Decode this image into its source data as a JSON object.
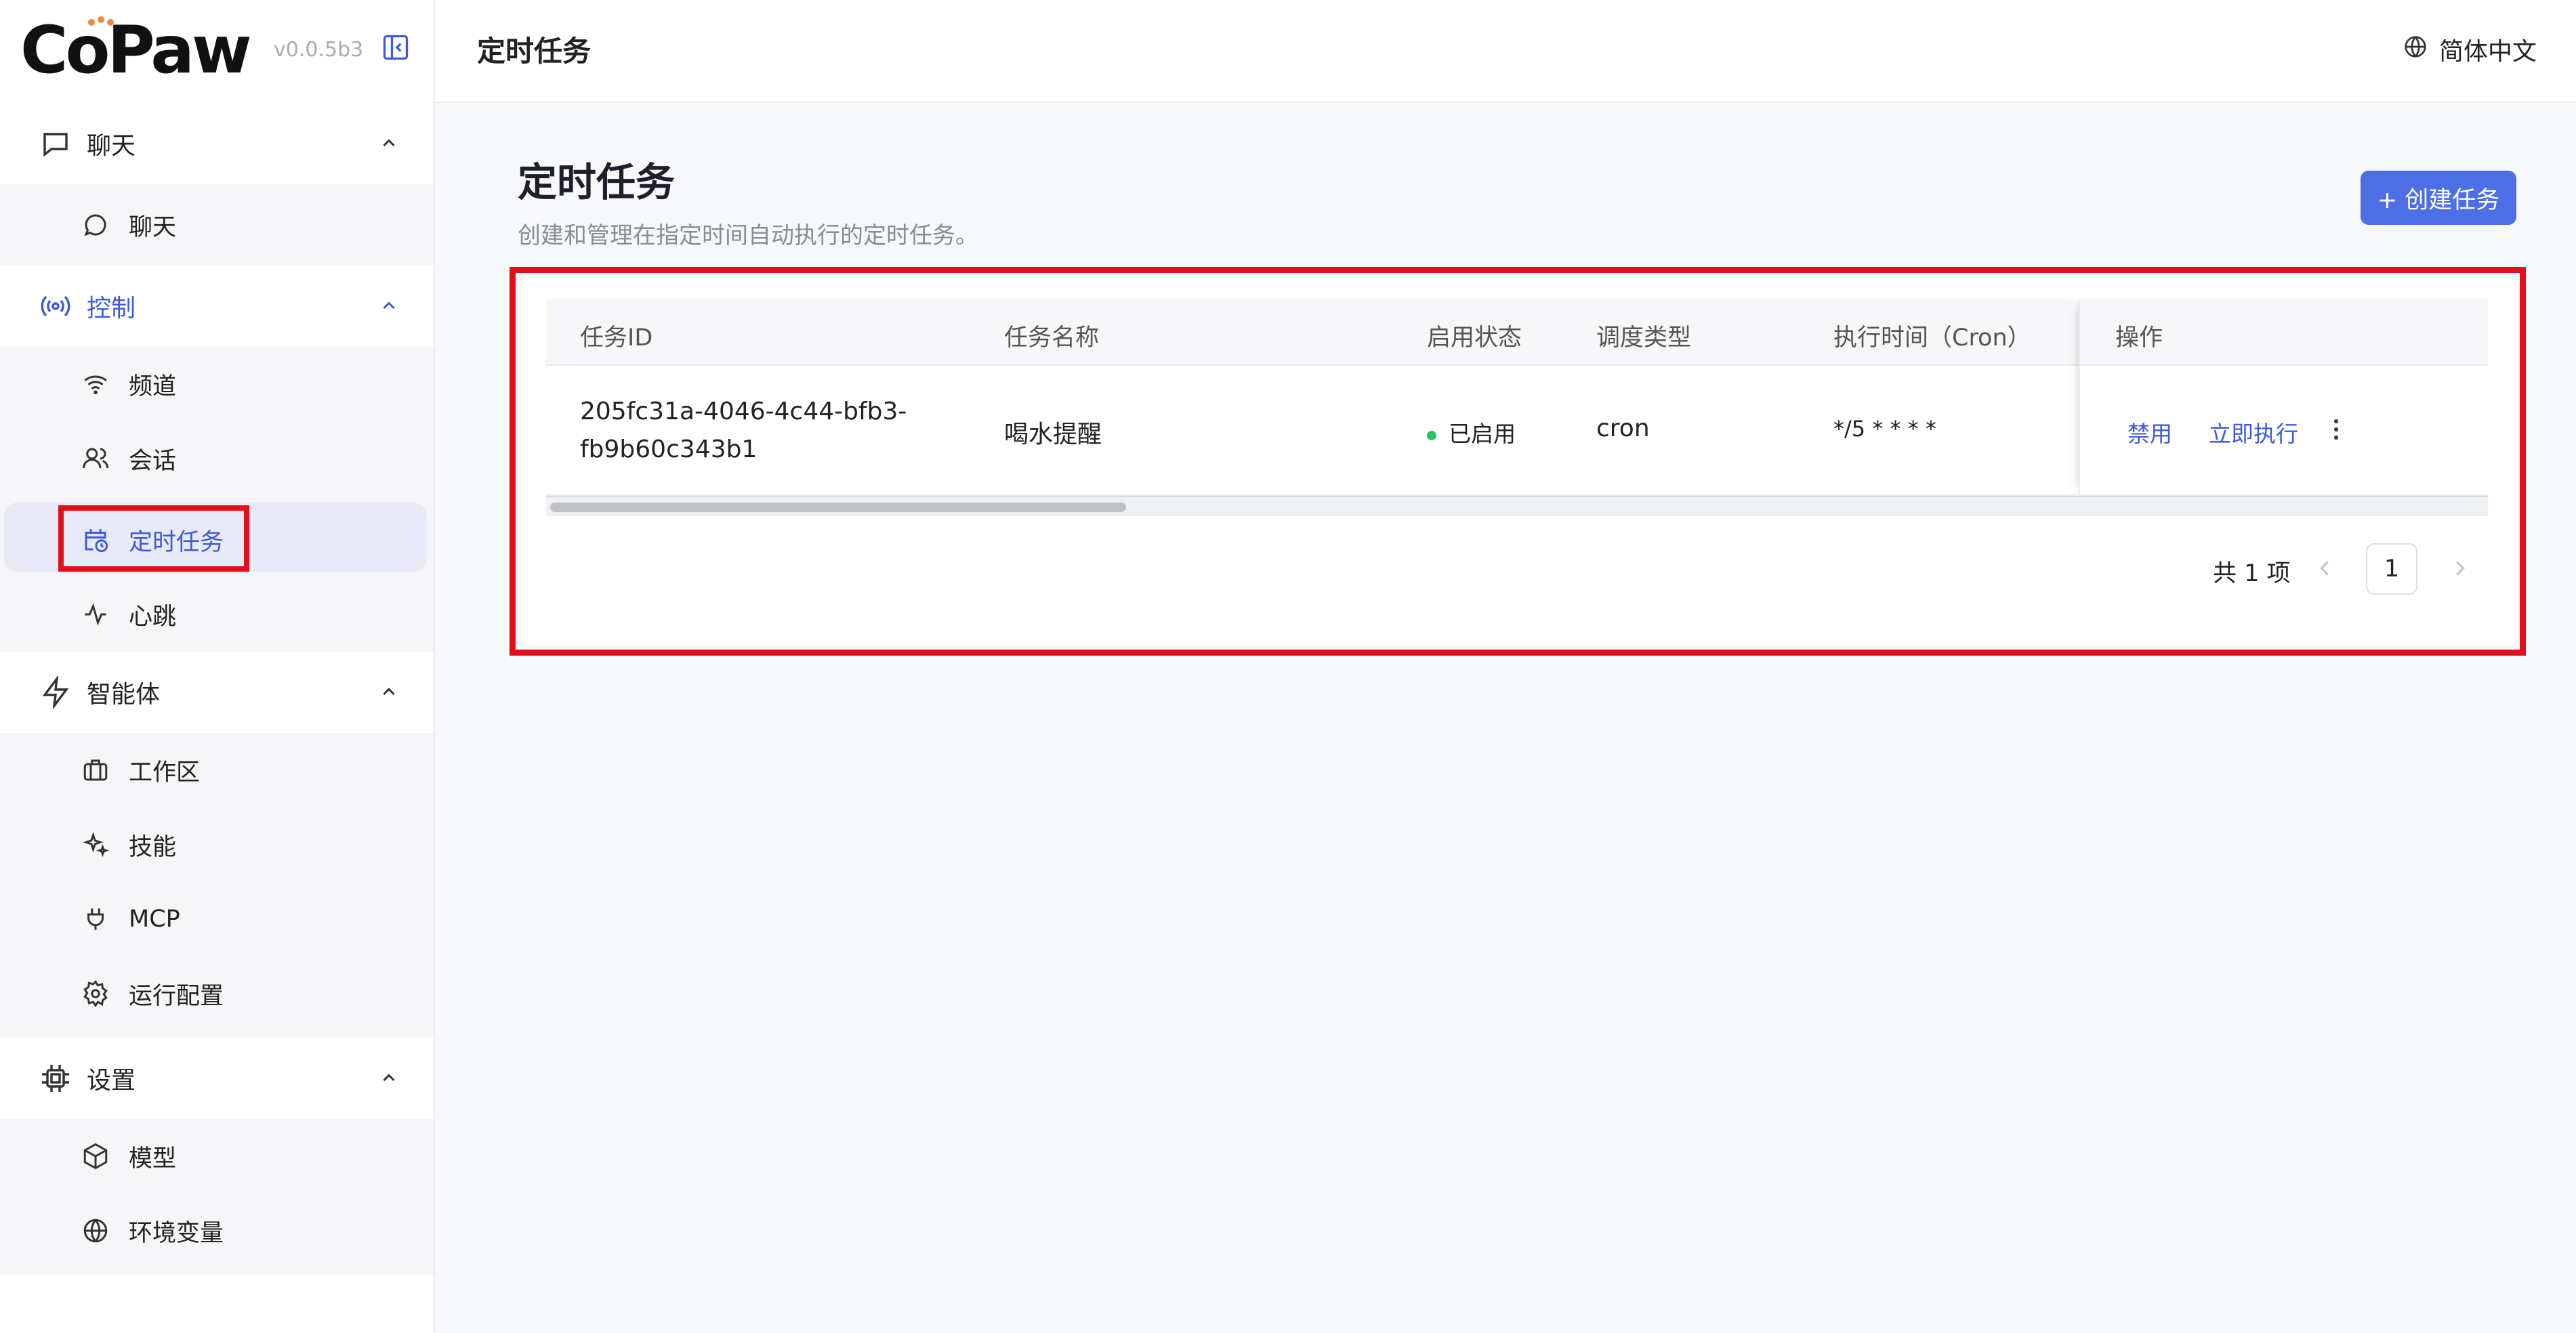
{
  "app": {
    "name": "CoPaw",
    "version": "v0.0.5b3"
  },
  "header": {
    "title": "定时任务",
    "language": "简体中文"
  },
  "sidebar": {
    "groups": [
      {
        "label": "聊天",
        "items": [
          {
            "label": "聊天",
            "icon": "chat-bubble-icon"
          }
        ]
      },
      {
        "label": "控制",
        "active": true,
        "items": [
          {
            "label": "频道",
            "icon": "wifi-icon"
          },
          {
            "label": "会话",
            "icon": "users-icon"
          },
          {
            "label": "定时任务",
            "icon": "calendar-clock-icon",
            "selected": true
          },
          {
            "label": "心跳",
            "icon": "pulse-icon"
          }
        ]
      },
      {
        "label": "智能体",
        "items": [
          {
            "label": "工作区",
            "icon": "briefcase-icon"
          },
          {
            "label": "技能",
            "icon": "sparkles-icon"
          },
          {
            "label": "MCP",
            "icon": "plug-icon"
          },
          {
            "label": "运行配置",
            "icon": "gear-icon"
          }
        ]
      },
      {
        "label": "设置",
        "items": [
          {
            "label": "模型",
            "icon": "cube-icon"
          },
          {
            "label": "环境变量",
            "icon": "globe-icon"
          }
        ]
      }
    ]
  },
  "main": {
    "title": "定时任务",
    "description": "创建和管理在指定时间自动执行的定时任务。",
    "create_button": "+ 创建任务",
    "table": {
      "columns": [
        "任务ID",
        "任务名称",
        "启用状态",
        "调度类型",
        "执行时间（Cron）",
        "操作"
      ],
      "rows": [
        {
          "id_line1": "205fc31a-4046-4c44-bfb3-",
          "id_line2": "fb9b60c343b1",
          "name": "喝水提醒",
          "status": "已启用",
          "schedule_type": "cron",
          "cron": "*/5 * * * *",
          "actions": {
            "disable": "禁用",
            "run_now": "立即执行"
          }
        }
      ]
    },
    "pagination": {
      "total": "共 1 项",
      "current_page": "1"
    }
  },
  "colors": {
    "accent": "#3d5bd9",
    "button": "#4c6fe6",
    "status_enabled": "#22c55e",
    "highlight": "#e3101c"
  }
}
